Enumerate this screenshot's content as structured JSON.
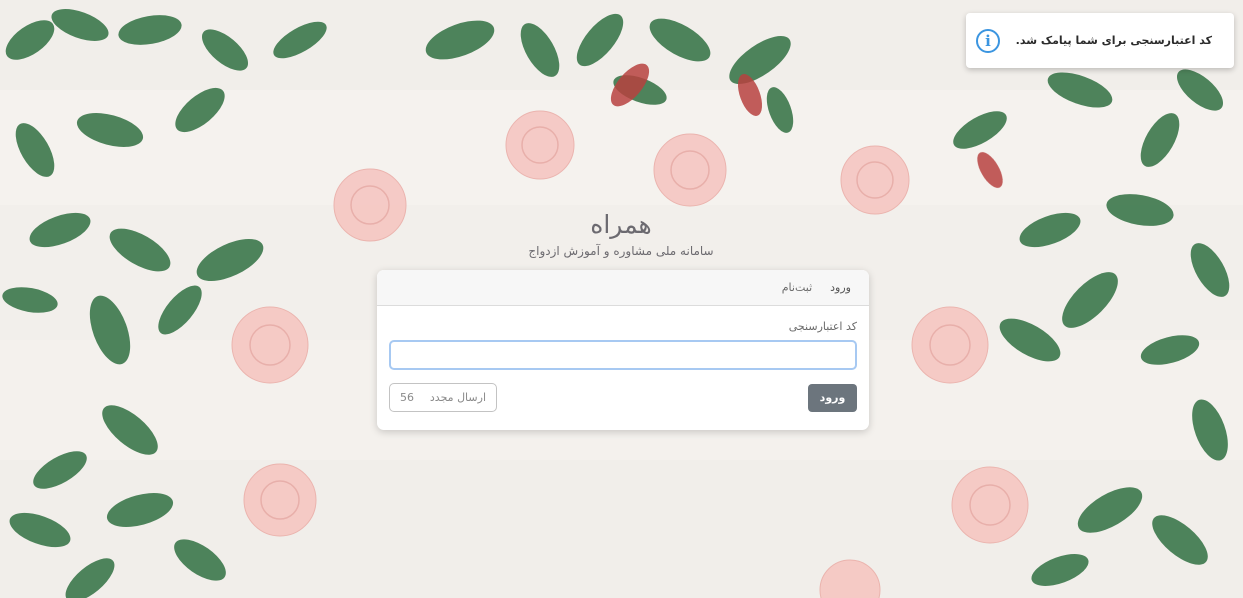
{
  "toast": {
    "icon": "info-circle-icon",
    "message": "کد اعتبارسنجی برای شما پیامک شد.",
    "accent_color": "#3b95e0"
  },
  "brand": {
    "logo_text": "همراه",
    "subtitle": "سامانه ملی مشاوره و آموزش ازدواج"
  },
  "card": {
    "tabs": [
      {
        "label": "ورود",
        "active": true
      },
      {
        "label": "ثبت‌نام",
        "active": false
      }
    ],
    "code_label": "کد اعتبارسنجی",
    "code_value": "",
    "login_button": "ورود",
    "resend_button": "ارسال مجدد",
    "resend_countdown": "56"
  }
}
